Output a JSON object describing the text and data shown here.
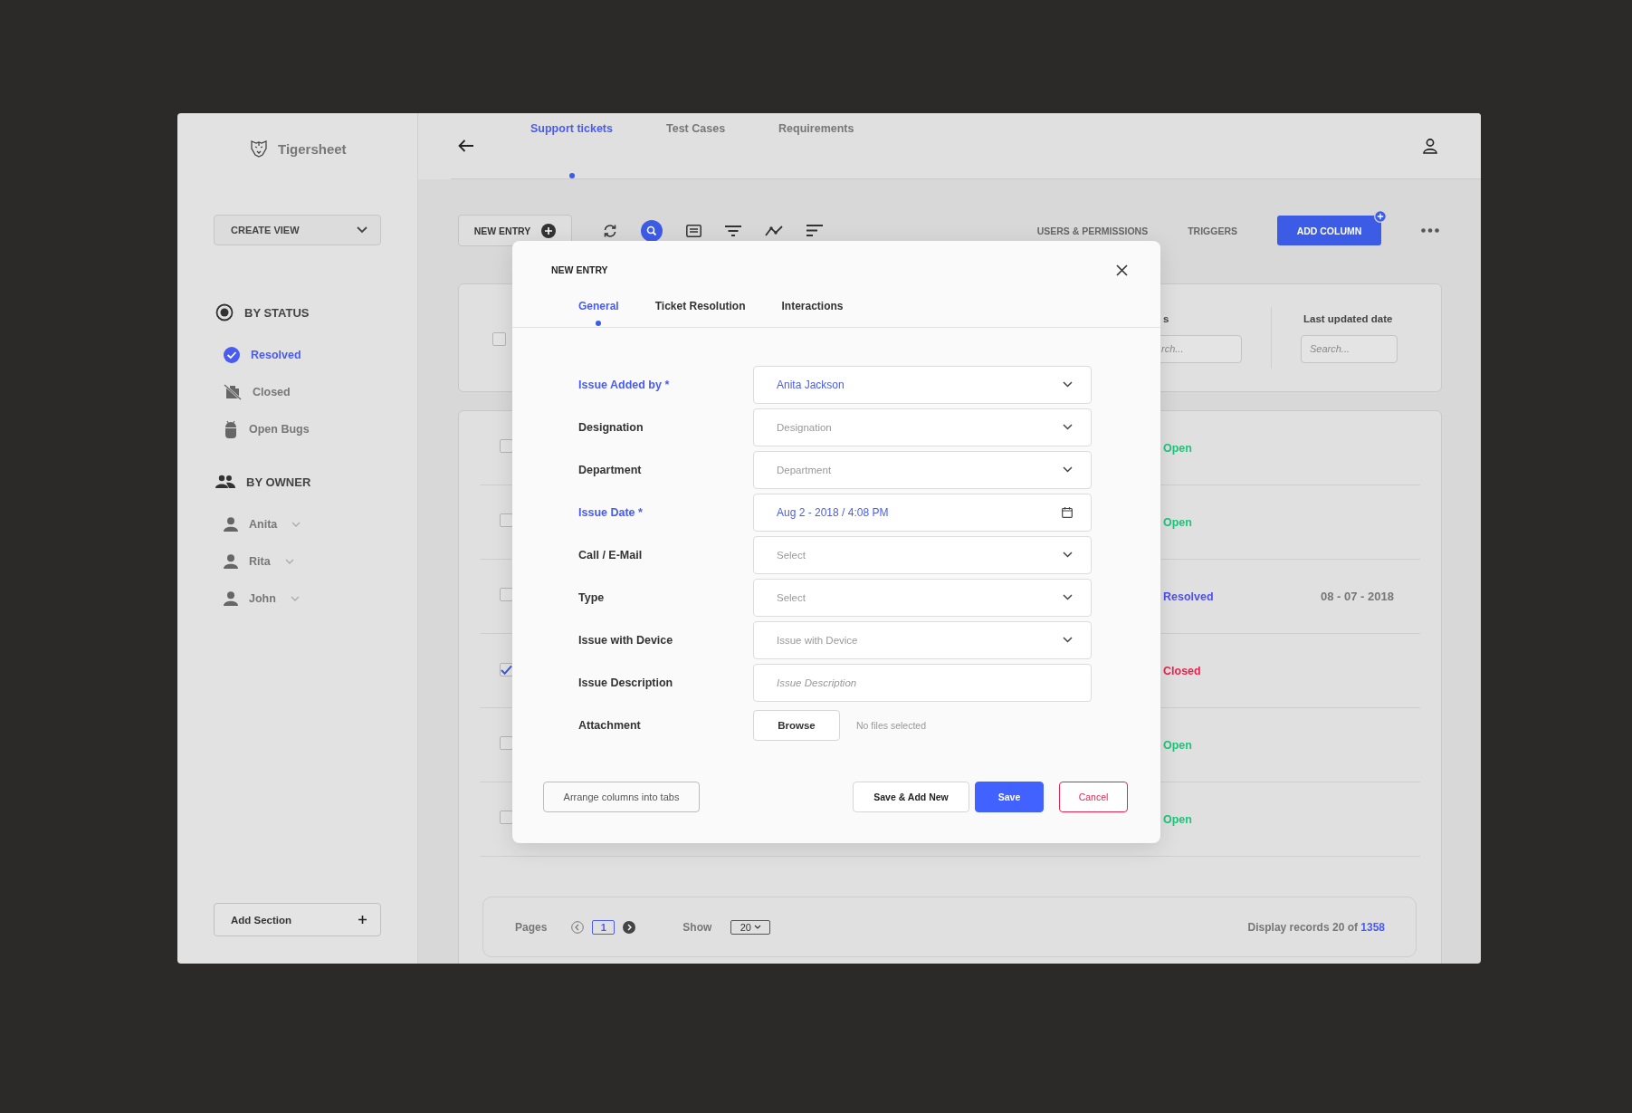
{
  "app": {
    "name": "Tigersheet"
  },
  "sidebar": {
    "create_view": "CREATE VIEW",
    "add_section": "Add Section",
    "sections": [
      {
        "title": "BY STATUS",
        "kind": "status",
        "items": [
          {
            "label": "Resolved",
            "selected": true
          },
          {
            "label": "Closed",
            "selected": false
          },
          {
            "label": "Open Bugs",
            "selected": false
          }
        ]
      },
      {
        "title": "BY OWNER",
        "kind": "owner",
        "items": [
          {
            "label": "Anita"
          },
          {
            "label": "Rita"
          },
          {
            "label": "John"
          }
        ]
      }
    ]
  },
  "top_tabs": [
    {
      "label": "Support tickets",
      "selected": true
    },
    {
      "label": "Test Cases",
      "selected": false
    },
    {
      "label": "Requirements",
      "selected": false
    }
  ],
  "toolbar": {
    "new_entry": "NEW ENTRY",
    "links": [
      "USERS & PERMISSIONS",
      "TRIGGERS"
    ],
    "add_column": "ADD COLUMN"
  },
  "filters": {
    "checked": false,
    "columns": [
      {
        "label": "s",
        "placeholder": "rch..."
      },
      {
        "label": "Last updated date",
        "placeholder": "Search..."
      }
    ]
  },
  "rows": [
    {
      "checked": false,
      "status": "Open",
      "color": "#1fc57a"
    },
    {
      "checked": false,
      "status": "Open",
      "color": "#1fc57a"
    },
    {
      "checked": false,
      "status": "Resolved",
      "color": "#5050e8",
      "date": "08 - 07 - 2018"
    },
    {
      "checked": true,
      "status": "Closed",
      "color": "#e8234f"
    },
    {
      "checked": false,
      "status": "Open",
      "color": "#1fc57a"
    },
    {
      "checked": false,
      "status": "Open",
      "color": "#1fc57a"
    }
  ],
  "pagination": {
    "pages_label": "Pages",
    "current_page": "1",
    "show_label": "Show",
    "page_size": "20",
    "display_text": "Display records 20 of",
    "total": "1358"
  },
  "modal": {
    "title": "NEW ENTRY",
    "tabs": [
      {
        "label": "General",
        "selected": true
      },
      {
        "label": "Ticket Resolution",
        "selected": false
      },
      {
        "label": "Interactions",
        "selected": false
      }
    ],
    "fields": [
      {
        "label": "Issue Added by *",
        "required": true,
        "kind": "dropdown",
        "value": "Anita Jackson"
      },
      {
        "label": "Designation",
        "required": false,
        "kind": "dropdown",
        "placeholder": "Designation"
      },
      {
        "label": "Department",
        "required": false,
        "kind": "dropdown",
        "placeholder": "Department"
      },
      {
        "label": "Issue Date *",
        "required": true,
        "kind": "date",
        "value": "Aug 2 - 2018 / 4:08 PM"
      },
      {
        "label": "Call / E-Mail",
        "required": false,
        "kind": "dropdown",
        "placeholder": "Select"
      },
      {
        "label": "Type",
        "required": false,
        "kind": "dropdown",
        "placeholder": "Select"
      },
      {
        "label": "Issue with Device",
        "required": false,
        "kind": "dropdown",
        "placeholder": "Issue with Device"
      },
      {
        "label": "Issue Description",
        "required": false,
        "kind": "text",
        "placeholder": "Issue Description"
      },
      {
        "label": "Attachment",
        "required": false,
        "kind": "file",
        "button": "Browse",
        "status": "No files selected"
      }
    ],
    "arrange": "Arrange columns into tabs",
    "buttons": [
      {
        "label": "Save & Add New",
        "kind": "secondary"
      },
      {
        "label": "Save",
        "kind": "primary"
      },
      {
        "label": "Cancel",
        "kind": "danger"
      }
    ]
  }
}
